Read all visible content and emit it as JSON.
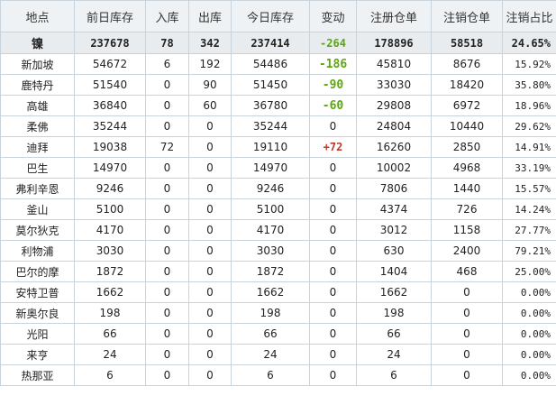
{
  "table": {
    "headers": [
      "地点",
      "前日库存",
      "入库",
      "出库",
      "今日库存",
      "变动",
      "注册仓单",
      "注销仓单",
      "注销占比"
    ],
    "total": [
      "镍",
      "237678",
      "78",
      "342",
      "237414",
      "-264",
      "178896",
      "58518",
      "24.65%"
    ],
    "rows": [
      [
        "新加坡",
        "54672",
        "6",
        "192",
        "54486",
        "-186",
        "45810",
        "8676",
        "15.92%"
      ],
      [
        "鹿特丹",
        "51540",
        "0",
        "90",
        "51450",
        "-90",
        "33030",
        "18420",
        "35.80%"
      ],
      [
        "高雄",
        "36840",
        "0",
        "60",
        "36780",
        "-60",
        "29808",
        "6972",
        "18.96%"
      ],
      [
        "柔佛",
        "35244",
        "0",
        "0",
        "35244",
        "0",
        "24804",
        "10440",
        "29.62%"
      ],
      [
        "迪拜",
        "19038",
        "72",
        "0",
        "19110",
        "+72",
        "16260",
        "2850",
        "14.91%"
      ],
      [
        "巴生",
        "14970",
        "0",
        "0",
        "14970",
        "0",
        "10002",
        "4968",
        "33.19%"
      ],
      [
        "弗利辛恩",
        "9246",
        "0",
        "0",
        "9246",
        "0",
        "7806",
        "1440",
        "15.57%"
      ],
      [
        "釜山",
        "5100",
        "0",
        "0",
        "5100",
        "0",
        "4374",
        "726",
        "14.24%"
      ],
      [
        "莫尔狄克",
        "4170",
        "0",
        "0",
        "4170",
        "0",
        "3012",
        "1158",
        "27.77%"
      ],
      [
        "利物浦",
        "3030",
        "0",
        "0",
        "3030",
        "0",
        "630",
        "2400",
        "79.21%"
      ],
      [
        "巴尔的摩",
        "1872",
        "0",
        "0",
        "1872",
        "0",
        "1404",
        "468",
        "25.00%"
      ],
      [
        "安特卫普",
        "1662",
        "0",
        "0",
        "1662",
        "0",
        "1662",
        "0",
        "0.00%"
      ],
      [
        "新奥尔良",
        "198",
        "0",
        "0",
        "198",
        "0",
        "198",
        "0",
        "0.00%"
      ],
      [
        "光阳",
        "66",
        "0",
        "0",
        "66",
        "0",
        "66",
        "0",
        "0.00%"
      ],
      [
        "来亨",
        "24",
        "0",
        "0",
        "24",
        "0",
        "24",
        "0",
        "0.00%"
      ],
      [
        "热那亚",
        "6",
        "0",
        "0",
        "6",
        "0",
        "6",
        "0",
        "0.00%"
      ]
    ]
  },
  "colors": {
    "decrease": "#5aa80a",
    "increase": "#c0392b",
    "header_bg": "#eef2f4",
    "total_bg": "#e8ecef",
    "grid": "#c9d3db"
  }
}
